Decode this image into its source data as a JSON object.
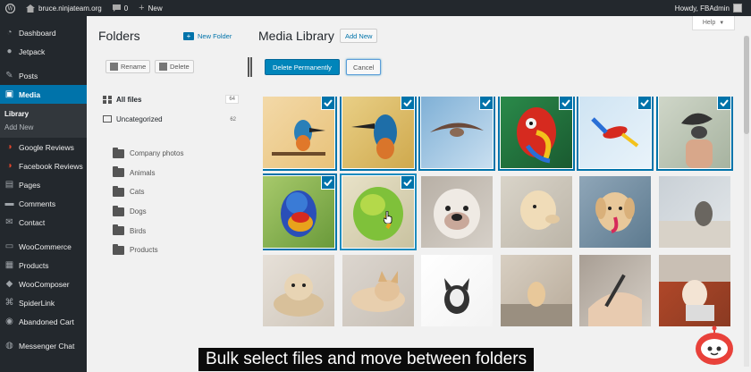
{
  "adminbar": {
    "site_name": "bruce.ninjateam.org",
    "comments_count": "0",
    "new_label": "New",
    "howdy": "Howdy, FBAdmin"
  },
  "sidebar": {
    "items": [
      {
        "label": "Dashboard",
        "icon": "dashboard-icon"
      },
      {
        "label": "Jetpack",
        "icon": "jetpack-icon"
      },
      {
        "label": "Posts",
        "icon": "pin-icon"
      },
      {
        "label": "Media",
        "icon": "media-icon",
        "active": true
      },
      {
        "label": "Google Reviews",
        "icon": "google-reviews-icon"
      },
      {
        "label": "Facebook Reviews",
        "icon": "facebook-reviews-icon"
      },
      {
        "label": "Pages",
        "icon": "pages-icon"
      },
      {
        "label": "Comments",
        "icon": "comments-icon"
      },
      {
        "label": "Contact",
        "icon": "contact-icon"
      },
      {
        "label": "WooCommerce",
        "icon": "woocommerce-icon"
      },
      {
        "label": "Products",
        "icon": "products-icon"
      },
      {
        "label": "WooComposer",
        "icon": "woocomposer-icon"
      },
      {
        "label": "SpiderLink",
        "icon": "spiderlink-icon"
      },
      {
        "label": "Abandoned Cart",
        "icon": "cart-icon"
      },
      {
        "label": "Messenger Chat",
        "icon": "messenger-icon"
      }
    ],
    "media_sub": [
      "Library",
      "Add New"
    ]
  },
  "folders": {
    "title": "Folders",
    "new_folder": "New Folder",
    "rename": "Rename",
    "delete": "Delete",
    "all_files": "All files",
    "all_files_count": "64",
    "uncategorized": "Uncategorized",
    "uncategorized_count": "62",
    "list": [
      "Company photos",
      "Animals",
      "Cats",
      "Dogs",
      "Birds",
      "Products"
    ]
  },
  "main": {
    "title": "Media Library",
    "add_new": "Add New",
    "help": "Help",
    "delete_permanently": "Delete Permanently",
    "cancel": "Cancel"
  },
  "media_items": [
    {
      "subject": "kingfisher on branch",
      "selected": true
    },
    {
      "subject": "kingfisher close-up",
      "selected": true
    },
    {
      "subject": "bird in flight",
      "selected": true
    },
    {
      "subject": "red macaw parrot",
      "selected": true
    },
    {
      "subject": "flying parrot",
      "selected": true
    },
    {
      "subject": "bird on hand",
      "selected": true
    },
    {
      "subject": "rainbow lorikeet",
      "selected": true
    },
    {
      "subject": "green parrot",
      "selected": true,
      "focused": true
    },
    {
      "subject": "bulldog",
      "selected": false
    },
    {
      "subject": "labrador",
      "selected": false
    },
    {
      "subject": "golden retriever puppy",
      "selected": false
    },
    {
      "subject": "dog on beach",
      "selected": false
    },
    {
      "subject": "puppy on bed",
      "selected": false
    },
    {
      "subject": "small dog lying",
      "selected": false
    },
    {
      "subject": "terrier head",
      "selected": false
    },
    {
      "subject": "dog on street",
      "selected": false
    },
    {
      "subject": "hand with pen",
      "selected": false
    },
    {
      "subject": "woman with laptop",
      "selected": false
    }
  ],
  "caption": "Bulk select files and move between folders",
  "colors": {
    "accent": "#0073aa",
    "sidebar_bg": "#23282d",
    "primary_button": "#0085ba"
  }
}
